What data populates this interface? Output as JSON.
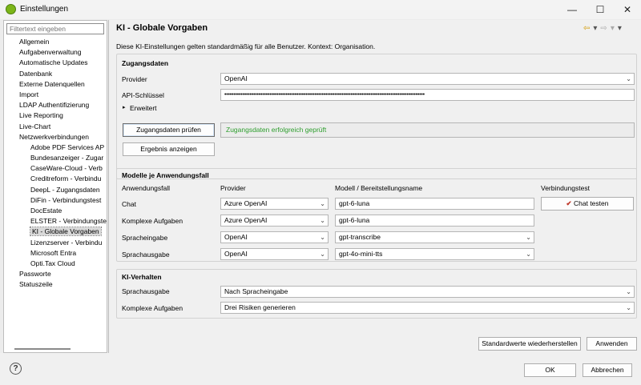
{
  "window": {
    "title": "Einstellungen",
    "minimize_icon": "—",
    "maximize_icon": "☐",
    "close_icon": "✕"
  },
  "sidebar": {
    "filter_placeholder": "Filtertext eingeben",
    "items": [
      {
        "label": "Allgemein",
        "level": 1
      },
      {
        "label": "Aufgabenverwaltung",
        "level": 1
      },
      {
        "label": "Automatische Updates",
        "level": 1
      },
      {
        "label": "Datenbank",
        "level": 1
      },
      {
        "label": "Externe Datenquellen",
        "level": 1
      },
      {
        "label": "Import",
        "level": 1
      },
      {
        "label": "LDAP Authentifizierung",
        "level": 1
      },
      {
        "label": "Live Reporting",
        "level": 1
      },
      {
        "label": "Live-Chart",
        "level": 1
      },
      {
        "label": "Netzwerkverbindungen",
        "level": 1
      },
      {
        "label": "Adobe PDF Services AP",
        "level": 2
      },
      {
        "label": "Bundesanzeiger - Zugar",
        "level": 2
      },
      {
        "label": "CaseWare-Cloud - Verb",
        "level": 2
      },
      {
        "label": "Creditreform - Verbindu",
        "level": 2
      },
      {
        "label": "DeepL - Zugangsdaten",
        "level": 2
      },
      {
        "label": "DiFin - Verbindungstest",
        "level": 2
      },
      {
        "label": "DocEstate",
        "level": 2
      },
      {
        "label": "ELSTER - Verbindungste",
        "level": 2
      },
      {
        "label": "KI - Globale Vorgaben",
        "level": 2,
        "selected": true
      },
      {
        "label": "Lizenzserver - Verbindu",
        "level": 2
      },
      {
        "label": "Microsoft Entra",
        "level": 2
      },
      {
        "label": "Opti.Tax Cloud",
        "level": 2
      },
      {
        "label": "Passworte",
        "level": 1
      },
      {
        "label": "Statuszeile",
        "level": 1
      }
    ]
  },
  "main": {
    "title": "KI - Globale Vorgaben",
    "description": "Diese KI-Einstellungen gelten standardmäßig für alle Benutzer. Kontext: Organisation.",
    "nav": {
      "back": "⇦",
      "back_menu": "▾",
      "forward": "⇨",
      "forward_menu": "▾",
      "menu": "▾"
    },
    "zugangsdaten": {
      "title": "Zugangsdaten",
      "provider_label": "Provider",
      "provider_value": "OpenAI",
      "api_key_label": "API-Schlüssel",
      "api_key_value": "•••••••••••••••••••••••••••••••••••••••••••••••••••••••••••••••••••••••••••••••••••••••••••••••••••••••••••••••",
      "advanced_toggle": "▸",
      "advanced_label": "Erweitert",
      "check_button": "Zugangsdaten prüfen",
      "status_text": "Zugangsdaten erfolgreich geprüft",
      "status_color": "#2e9e2e",
      "result_button": "Ergebnis anzeigen"
    },
    "modelle": {
      "title": "Modelle je Anwendungsfall",
      "headers": {
        "usecase": "Anwendungsfall",
        "provider": "Provider",
        "model": "Modell / Bereitstellungsname",
        "test": "Verbindungstest"
      },
      "rows": [
        {
          "usecase": "Chat",
          "provider": "Azure OpenAI",
          "model": "gpt-6-luna",
          "model_dropdown": false,
          "test_button": "Chat testen",
          "test_icon": "wand-check-icon"
        },
        {
          "usecase": "Komplexe Aufgaben",
          "provider": "Azure OpenAI",
          "model": "gpt-6-luna",
          "model_dropdown": false
        },
        {
          "usecase": "Spracheingabe",
          "provider": "OpenAI",
          "model": "gpt-transcribe",
          "model_dropdown": true
        },
        {
          "usecase": "Sprachausgabe",
          "provider": "OpenAI",
          "model": "gpt-4o-mini-tts",
          "model_dropdown": true
        }
      ]
    },
    "verhalten": {
      "title": "KI-Verhalten",
      "rows": [
        {
          "label": "Sprachausgabe",
          "value": "Nach Spracheingabe"
        },
        {
          "label": "Komplexe Aufgaben",
          "value": "Drei Risiken generieren"
        }
      ]
    },
    "restore_button": "Standardwerte wiederherstellen",
    "apply_button": "Anwenden"
  },
  "footer": {
    "help_icon": "?",
    "ok_button": "OK",
    "cancel_button": "Abbrechen"
  },
  "colors": {
    "accent_green": "#7cb518",
    "status_green": "#2e9e2e"
  }
}
